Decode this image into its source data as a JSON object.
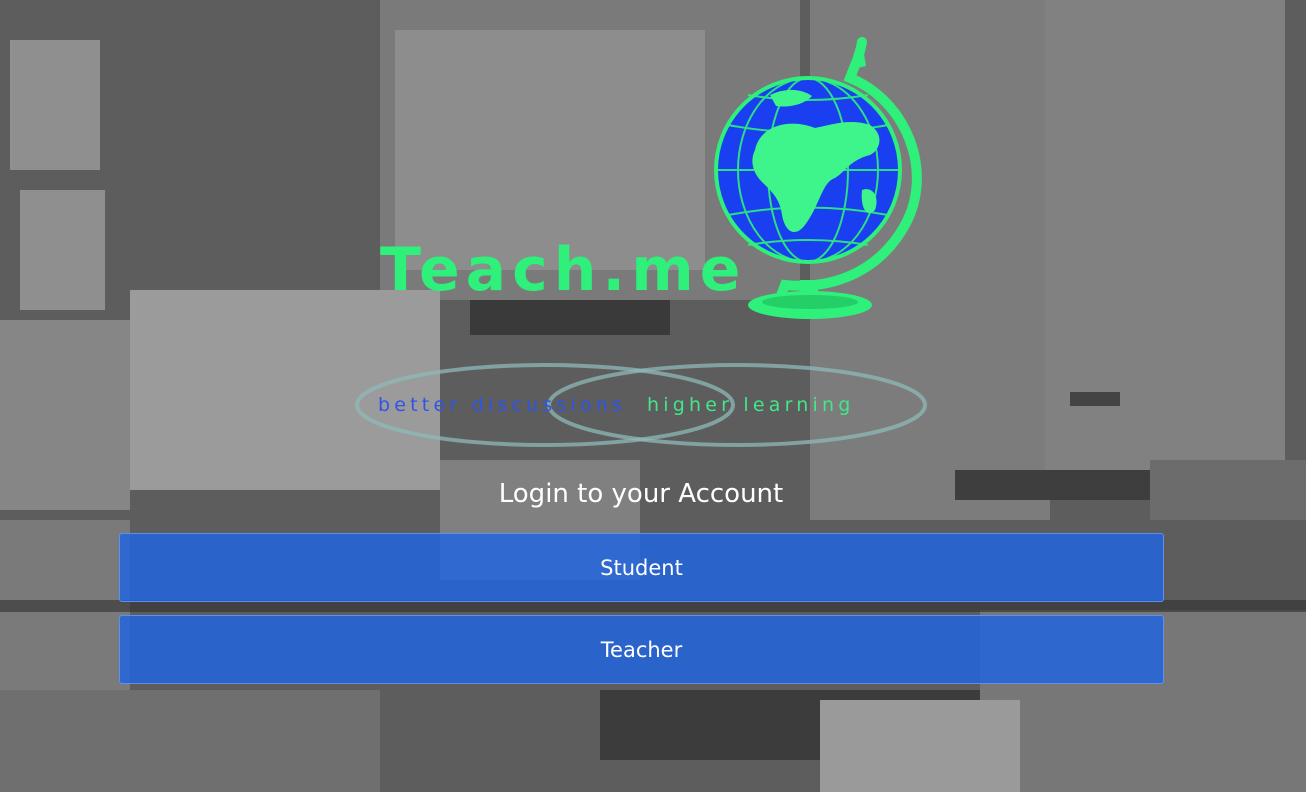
{
  "logo": {
    "name": "Teach.me",
    "tagline_left": "better discussions",
    "tagline_right": "higher learning",
    "icon": "globe-icon"
  },
  "login": {
    "heading": "Login to your Account",
    "student_label": "Student",
    "teacher_label": "Teacher"
  },
  "colors": {
    "brand_green": "#2ef07a",
    "brand_blue": "#1a3ff0",
    "button_blue": "#1e64e1"
  }
}
